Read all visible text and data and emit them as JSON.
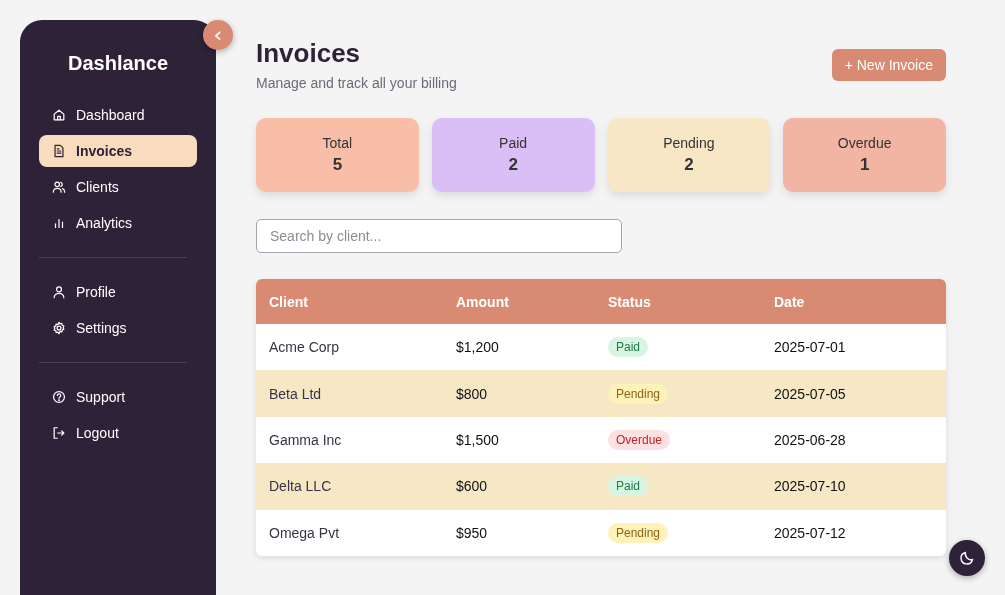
{
  "sidebar": {
    "brand": "Dashlance",
    "collapse_icon": "‹",
    "groups": [
      {
        "items": [
          {
            "label": "Dashboard",
            "selected": false
          },
          {
            "label": "Invoices",
            "selected": true
          },
          {
            "label": "Clients",
            "selected": false
          },
          {
            "label": "Analytics",
            "selected": false
          }
        ]
      },
      {
        "items": [
          {
            "label": "Profile",
            "selected": false
          },
          {
            "label": "Settings",
            "selected": false
          }
        ]
      },
      {
        "items": [
          {
            "label": "Support",
            "selected": false
          },
          {
            "label": "Logout",
            "selected": false
          }
        ]
      }
    ]
  },
  "header": {
    "title": "Invoices",
    "subtitle": "Manage and track all your billing",
    "new_button": "+ New Invoice"
  },
  "stats": [
    {
      "label": "Total",
      "value": "5",
      "color": "#f9bea8"
    },
    {
      "label": "Paid",
      "value": "2",
      "color": "#d9bff5"
    },
    {
      "label": "Pending",
      "value": "2",
      "color": "#f7e7c4"
    },
    {
      "label": "Overdue",
      "value": "1",
      "color": "#f2b4a3"
    }
  ],
  "search": {
    "placeholder": "Search by client..."
  },
  "table": {
    "columns": [
      "Client",
      "Amount",
      "Status",
      "Date"
    ],
    "rows": [
      {
        "client": "Acme Corp",
        "amount": "$1,200",
        "status": {
          "label": "Paid",
          "kind": "paid"
        },
        "date": "2025-07-01"
      },
      {
        "client": "Beta Ltd",
        "amount": "$800",
        "status": {
          "label": "Pending",
          "kind": "pending"
        },
        "date": "2025-07-05"
      },
      {
        "client": "Gamma Inc",
        "amount": "$1,500",
        "status": {
          "label": "Overdue",
          "kind": "overdue"
        },
        "date": "2025-06-28"
      },
      {
        "client": "Delta LLC",
        "amount": "$600",
        "status": {
          "label": "Paid",
          "kind": "paid"
        },
        "date": "2025-07-10"
      },
      {
        "client": "Omega Pvt",
        "amount": "$950",
        "status": {
          "label": "Pending",
          "kind": "pending"
        },
        "date": "2025-07-12"
      }
    ]
  }
}
